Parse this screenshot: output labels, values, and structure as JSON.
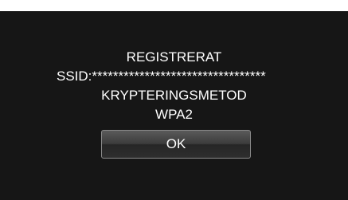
{
  "dialog": {
    "title": "REGISTRERAT",
    "ssid_line": "SSID:*********************************",
    "encryption_label": "KRYPTERINGSMETOD",
    "encryption_value": "WPA2",
    "ok_label": "OK"
  },
  "colors": {
    "screen_background": "#161616",
    "text": "#ffffff",
    "button_border": "#8a8a8a"
  }
}
